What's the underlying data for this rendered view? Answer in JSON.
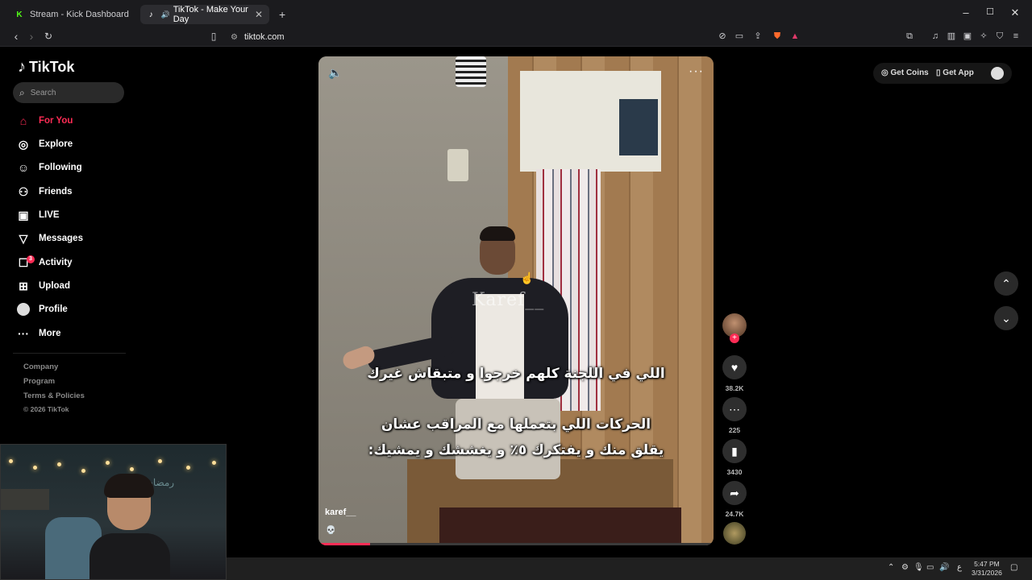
{
  "browser": {
    "tabs": [
      {
        "title": "Stream - Kick Dashboard",
        "favicon": "kick-icon"
      },
      {
        "title": "TikTok - Make Your Day",
        "favicon": "tiktok-icon"
      }
    ],
    "url": "tiktok.com"
  },
  "sidebar": {
    "logo": "TikTok",
    "search_placeholder": "Search",
    "items": [
      {
        "label": "For You",
        "icon": "home-icon"
      },
      {
        "label": "Explore",
        "icon": "compass-icon"
      },
      {
        "label": "Following",
        "icon": "following-icon"
      },
      {
        "label": "Friends",
        "icon": "friends-icon"
      },
      {
        "label": "LIVE",
        "icon": "live-icon"
      },
      {
        "label": "Messages",
        "icon": "messages-icon"
      },
      {
        "label": "Activity",
        "icon": "activity-icon",
        "badge": "3"
      },
      {
        "label": "Upload",
        "icon": "upload-icon"
      },
      {
        "label": "Profile",
        "icon": "profile-avatar"
      },
      {
        "label": "More",
        "icon": "more-icon"
      }
    ],
    "footer": [
      "Company",
      "Program",
      "Terms & Policies",
      "© 2026 TikTok"
    ]
  },
  "video": {
    "watermark": "Karef__",
    "caption_line1": "اللي في اللجنة كلهم خرجوا و متبقاش غيرك",
    "caption_line2": "الحركات اللي بتعملها مع المراقب عشان",
    "caption_line3": "يقلق منك و يفتكرك ٥٪ و يغششك و يمشيك:",
    "author": "karef__",
    "author_emoji": "💀",
    "progress": 0.13
  },
  "actions": {
    "likes": "38.2K",
    "comments": "225",
    "saves": "3430",
    "shares": "24.7K"
  },
  "topbar": {
    "get_coins": "Get Coins",
    "get_app": "Get App"
  },
  "webcam": {
    "overlay_text": "رمضان"
  },
  "taskbar": {
    "time": "5:47 PM",
    "date": "3/31/2026",
    "lang": "ع"
  },
  "colors": {
    "accent": "#fe2c55",
    "background": "#000000"
  }
}
